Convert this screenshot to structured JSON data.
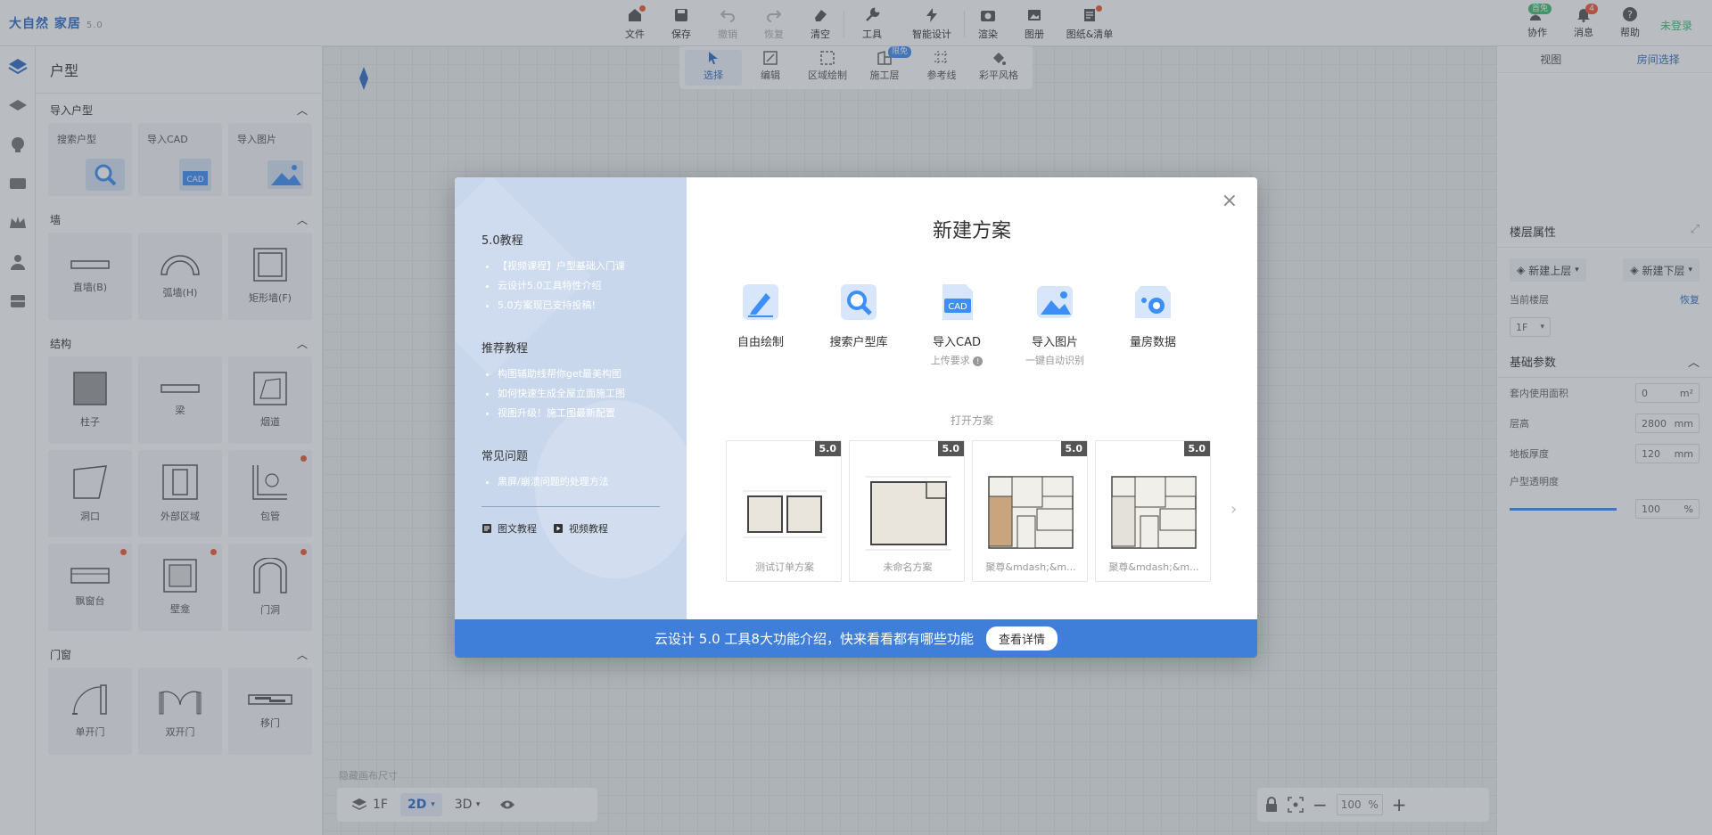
{
  "app": {
    "logo": "大自然 家居",
    "version": "5.0"
  },
  "toolbar": {
    "items": [
      {
        "label": "文件",
        "dot": true
      },
      {
        "label": "保存"
      },
      {
        "label": "撤销"
      },
      {
        "label": "恢复"
      },
      {
        "label": "清空"
      },
      {
        "label": "工具"
      },
      {
        "label": "智能设计"
      },
      {
        "label": "渲染"
      },
      {
        "label": "图册"
      },
      {
        "label": "图纸&清单",
        "dot": true
      }
    ]
  },
  "top_right": {
    "collab": "协作",
    "collab_badge": "首免",
    "messages": "消息",
    "messages_badge": "4",
    "help": "帮助",
    "login": "未登录"
  },
  "subtoolbar": {
    "items": [
      {
        "label": "选择"
      },
      {
        "label": "编辑"
      },
      {
        "label": "区域绘制"
      },
      {
        "label": "施工层",
        "badge": "限免"
      },
      {
        "label": "参考线"
      },
      {
        "label": "彩平风格"
      }
    ]
  },
  "left_panel": {
    "title": "户型",
    "sections": [
      {
        "title": "导入户型",
        "items": [
          "搜索户型",
          "导入CAD",
          "导入图片"
        ]
      },
      {
        "title": "墙",
        "items": [
          "直墙(B)",
          "弧墙(H)",
          "矩形墙(F)"
        ]
      },
      {
        "title": "结构",
        "items": [
          "柱子",
          "梁",
          "烟道",
          "洞口",
          "外部区域",
          "包管",
          "飘窗台",
          "壁龛",
          "门洞"
        ]
      },
      {
        "title": "门窗",
        "items": [
          "单开门",
          "双开门",
          "移门"
        ]
      }
    ]
  },
  "canvas": {
    "hint": "隐藏画布尺寸"
  },
  "bottom_left": {
    "floor": "1F",
    "view2d": "2D",
    "view3d": "3D"
  },
  "bottom_right": {
    "zoom": "100",
    "unit": "%"
  },
  "right_panel": {
    "tabs": [
      "视图",
      "房间选择"
    ],
    "floor_props": "楼层属性",
    "new_up": "新建上层",
    "new_down": "新建下层",
    "current_floor_label": "当前楼层",
    "restore": "恢复",
    "current_floor_value": "1F",
    "basic_params": "基础参数",
    "rows": [
      {
        "label": "套内使用面积",
        "value": "0",
        "unit": "m²"
      },
      {
        "label": "层高",
        "value": "2800",
        "unit": "mm"
      },
      {
        "label": "地板厚度",
        "value": "120",
        "unit": "mm"
      }
    ],
    "opacity_label": "户型透明度",
    "opacity_value": "100",
    "opacity_unit": "%",
    "opacity_level": 1.0
  },
  "modal": {
    "title": "新建方案",
    "side": {
      "sections": [
        {
          "title": "5.0教程",
          "items": [
            "【视频课程】户型基础入门课",
            "云设计5.0工具特性介绍",
            "5.0方案现已支持投稿!"
          ]
        },
        {
          "title": "推荐教程",
          "items": [
            "构图辅助线帮你get最美构图",
            "如何快速生成全屋立面施工图",
            "视图升级！施工图最新配置"
          ]
        },
        {
          "title": "常见问题",
          "items": [
            "黑屏/崩溃问题的处理方法"
          ]
        }
      ],
      "link_doc": "图文教程",
      "link_video": "视频教程"
    },
    "actions": [
      {
        "label": "自由绘制",
        "sub": ""
      },
      {
        "label": "搜索户型库",
        "sub": ""
      },
      {
        "label": "导入CAD",
        "sub": "上传要求"
      },
      {
        "label": "导入图片",
        "sub": "一键自动识别"
      },
      {
        "label": "量房数据",
        "sub": ""
      }
    ],
    "open_title": "打开方案",
    "plans": [
      {
        "name": "测试订单方案",
        "version": "5.0"
      },
      {
        "name": "未命名方案",
        "version": "5.0"
      },
      {
        "name": "聚尊&mdash;&m...",
        "version": "5.0"
      },
      {
        "name": "聚尊&mdash;&m...",
        "version": "5.0"
      }
    ],
    "banner_text": "云设计 5.0 工具8大功能介绍，快来看看都有哪些功能",
    "banner_button": "查看详情"
  },
  "colors": {
    "accent": "#2f6fc9",
    "banner": "#3f7fd9",
    "badge_red": "#f15a3a",
    "badge_green": "#3cbf72"
  }
}
